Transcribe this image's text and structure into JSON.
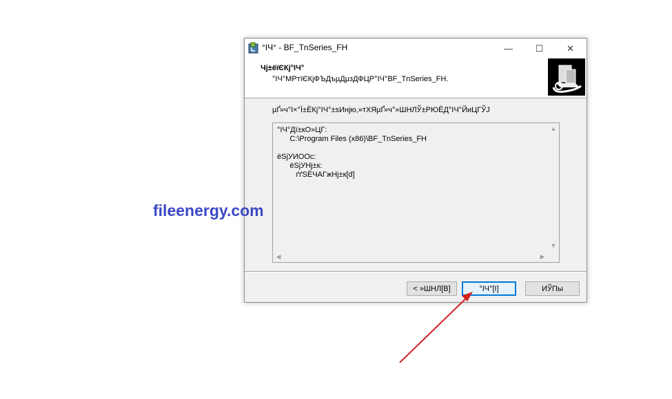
{
  "window": {
    "title": "°ІЧ° - BF_TnSeries_FH",
    "controls": {
      "minimize": "—",
      "maximize": "☐",
      "close": "✕"
    }
  },
  "header": {
    "title": "Чј±ёїЄКј°ІЧ°",
    "subtitle": "°ІЧ°МРтїЄКјФЪДъµДµзДФЦР°ІЧ°BF_TnSeries_FH."
  },
  "main": {
    "instruction": "µҐ»ч°І×°Ї±ЁКј°ІЧ°±ѕИнјю,»тХЯµҐ»ч°»ШНЛЎ±РЮЁД°ІЧ°ЙиЦГЎЈ",
    "details_lines": [
      "°ІЧ°Дї±кО»ЦГ:",
      "      C:\\Program Files (x86)\\BF_TnSeries_FH",
      "",
      "ёЅјУИООс:",
      "      ёЅјУНј±к:",
      "         ґґЅЁЧАГжНј±к[d]"
    ]
  },
  "buttons": {
    "back": "< »ШНЛ[B]",
    "install": "°ІЧ°[I]",
    "cancel": "ИЎПы"
  },
  "watermark": "fileenergy.com",
  "colors": {
    "accent": "#0078d7",
    "watermark": "#3b49c5",
    "annotation_arrow": "#d42020"
  },
  "icons": {
    "app": "installer-icon",
    "logo": "installer-logo-icon",
    "annotation": "red-arrow"
  }
}
